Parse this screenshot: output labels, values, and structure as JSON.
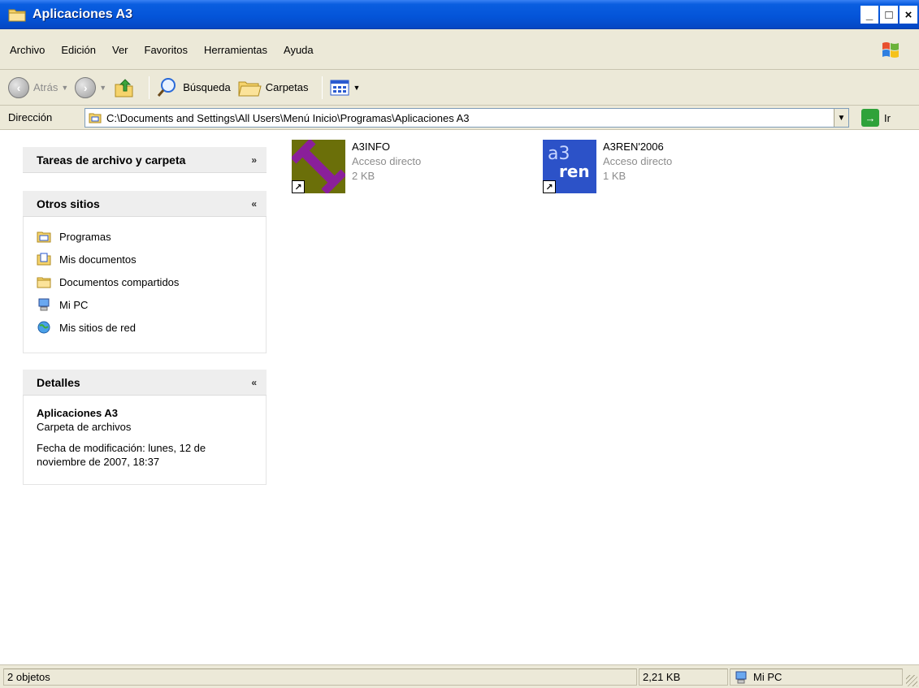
{
  "window": {
    "title": "Aplicaciones A3"
  },
  "menu": {
    "items": [
      "Archivo",
      "Edición",
      "Ver",
      "Favoritos",
      "Herramientas",
      "Ayuda"
    ]
  },
  "toolbar": {
    "back_label": "Atrás",
    "search_label": "Búsqueda",
    "folders_label": "Carpetas"
  },
  "address": {
    "label": "Dirección",
    "value": "C:\\Documents and Settings\\All Users\\Menú Inicio\\Programas\\Aplicaciones A3",
    "go_label": "Ir"
  },
  "taskpane": {
    "file_tasks": {
      "title": "Tareas de archivo y carpeta"
    },
    "other_places": {
      "title": "Otros sitios",
      "items": [
        {
          "label": "Programas",
          "icon": "programs-folder-icon"
        },
        {
          "label": "Mis documentos",
          "icon": "my-documents-icon"
        },
        {
          "label": "Documentos compartidos",
          "icon": "folder-icon"
        },
        {
          "label": "Mi PC",
          "icon": "computer-icon"
        },
        {
          "label": "Mis sitios de red",
          "icon": "network-icon"
        }
      ]
    },
    "details": {
      "title": "Detalles",
      "name": "Aplicaciones A3",
      "type": "Carpeta de archivos",
      "modified": "Fecha de modificación: lunes, 12 de noviembre de 2007, 18:37"
    }
  },
  "files": [
    {
      "name": "A3INFO",
      "type": "Acceso directo",
      "size": "2 KB",
      "icon": "a3info-icon"
    },
    {
      "name": "A3REN'2006",
      "type": "Acceso directo",
      "size": "1 KB",
      "icon": "a3ren-icon",
      "icon_text_top": "a3",
      "icon_text_bottom": "ren"
    }
  ],
  "statusbar": {
    "count": "2 objetos",
    "size": "2,21 KB",
    "location": "Mi PC"
  },
  "colors": {
    "titlebar": "#0454d8",
    "chrome": "#ece9d8",
    "a3info_bg": "#6b6f09",
    "a3info_fg": "#8a1f9a",
    "a3ren_bg": "#2c52c8"
  }
}
